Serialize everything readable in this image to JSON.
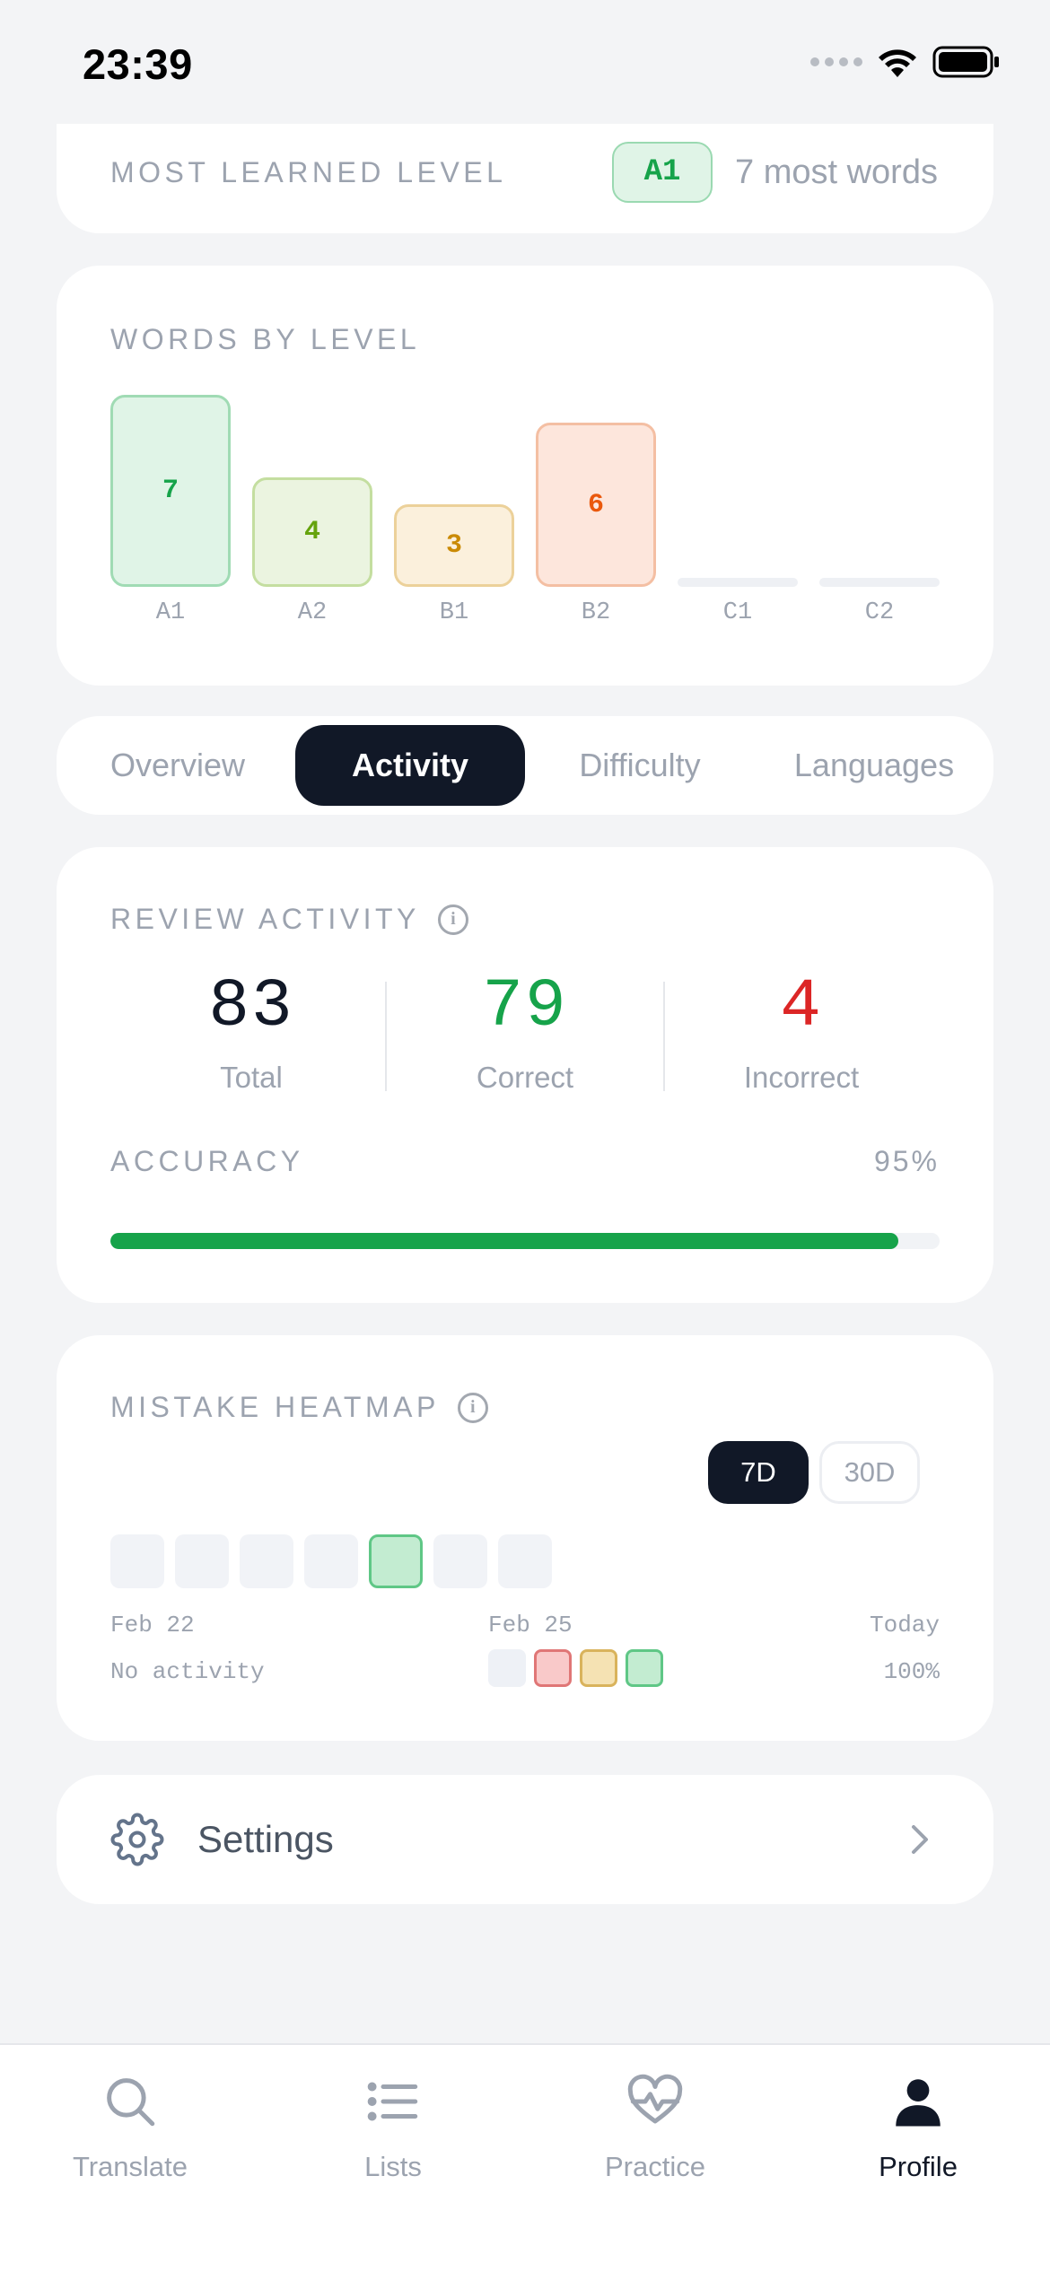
{
  "status_bar": {
    "time": "23:39"
  },
  "most_learned": {
    "label": "MOST LEARNED LEVEL",
    "level": "A1",
    "detail": "7 most words"
  },
  "words_by_level": {
    "title": "WORDS BY LEVEL",
    "levels": [
      {
        "label": "A1",
        "count": "7",
        "fill": "#e0f4e7",
        "border": "#a0dbb4",
        "text": "#16a34a"
      },
      {
        "label": "A2",
        "count": "4",
        "fill": "#ebf4e0",
        "border": "#c4dea0",
        "text": "#65a30d"
      },
      {
        "label": "B1",
        "count": "3",
        "fill": "#fbf0dc",
        "border": "#ecd19a",
        "text": "#ca8a04"
      },
      {
        "label": "B2",
        "count": "6",
        "fill": "#fde6dc",
        "border": "#f4bfa3",
        "text": "#ea580c"
      },
      {
        "label": "C1",
        "count": "0"
      },
      {
        "label": "C2",
        "count": "0"
      }
    ]
  },
  "tabs": [
    {
      "label": "Overview",
      "active": false
    },
    {
      "label": "Activity",
      "active": true
    },
    {
      "label": "Difficulty",
      "active": false
    },
    {
      "label": "Languages",
      "active": false
    }
  ],
  "review_activity": {
    "title": "REVIEW ACTIVITY",
    "stats": [
      {
        "value": "83",
        "label": "Total",
        "color": "#111827"
      },
      {
        "value": "79",
        "label": "Correct",
        "color": "#16a34a"
      },
      {
        "value": "4",
        "label": "Incorrect",
        "color": "#dc2626"
      }
    ],
    "accuracy_label": "ACCURACY",
    "accuracy_value": "95%",
    "accuracy_fraction": 0.95
  },
  "mistake_heatmap": {
    "title": "MISTAKE HEATMAP",
    "ranges": [
      {
        "label": "7D",
        "active": true
      },
      {
        "label": "30D",
        "active": false
      }
    ],
    "days": [
      {
        "state": "none"
      },
      {
        "state": "none"
      },
      {
        "state": "none"
      },
      {
        "state": "none"
      },
      {
        "state": "correct"
      },
      {
        "state": "none"
      },
      {
        "state": "none"
      }
    ],
    "date_start": "Feb 22",
    "date_mid": "Feb 25",
    "date_end": "Today",
    "legend_left": "No activity",
    "legend_right": "100%",
    "legend_colors": [
      "#eef1f6",
      "#f9c9c9",
      "#f5e2b3",
      "#c3ecd1"
    ]
  },
  "settings": {
    "label": "Settings"
  },
  "bottom_nav": [
    {
      "label": "Translate",
      "icon": "search-icon",
      "active": false
    },
    {
      "label": "Lists",
      "icon": "list-icon",
      "active": false
    },
    {
      "label": "Practice",
      "icon": "heart-pulse-icon",
      "active": false
    },
    {
      "label": "Profile",
      "icon": "person-icon",
      "active": true
    }
  ]
}
